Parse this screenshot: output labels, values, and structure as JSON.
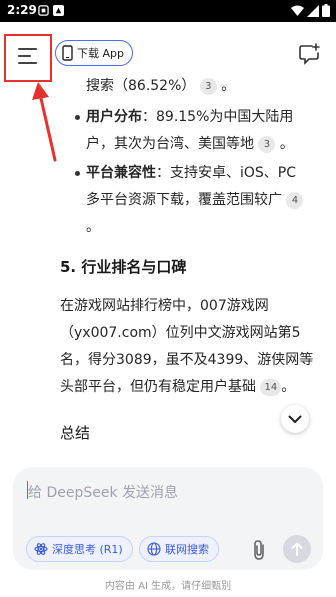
{
  "status_bar": {
    "time": "2:29"
  },
  "top_bar": {
    "download_app_label": "下载 App"
  },
  "content": {
    "line0_text": "搜索（86.52%）",
    "line0_cite": "3",
    "bullet1_title": "用户分布",
    "bullet1_line1": "：89.15%为中国大陆用",
    "bullet1_line2": "户，其次为台湾、美国等地",
    "bullet1_cite": "3",
    "bullet2_title": "平台兼容性",
    "bullet2_line1": "：支持安卓、iOS、PC",
    "bullet2_line2": "多平台资源下载，覆盖范围较广",
    "bullet2_cite": "4",
    "bullet2_line3": "。",
    "heading": "5. 行业排名与口碑",
    "para_line1": "在游戏网站排行榜中，007游戏网",
    "para_line2": "（yx007.com）位列中文游戏网站第5",
    "para_line3": "名，得分3089，虽不及4399、游侠网等",
    "para_line4": "头部平台，但仍有稳定用户基础",
    "para_cite": "14",
    "para_end": "。",
    "summary": "总结"
  },
  "input": {
    "placeholder": "给 DeepSeek 发送消息",
    "deep_think_label": "深度思考 (R1)",
    "web_search_label": "联网搜索"
  },
  "footer": {
    "disclaimer": "内容由 AI 生成，请仔细甄别"
  },
  "colors": {
    "accent": "#4d6bfe",
    "highlight_box": "#e5322d",
    "arrow": "#e5322d"
  }
}
